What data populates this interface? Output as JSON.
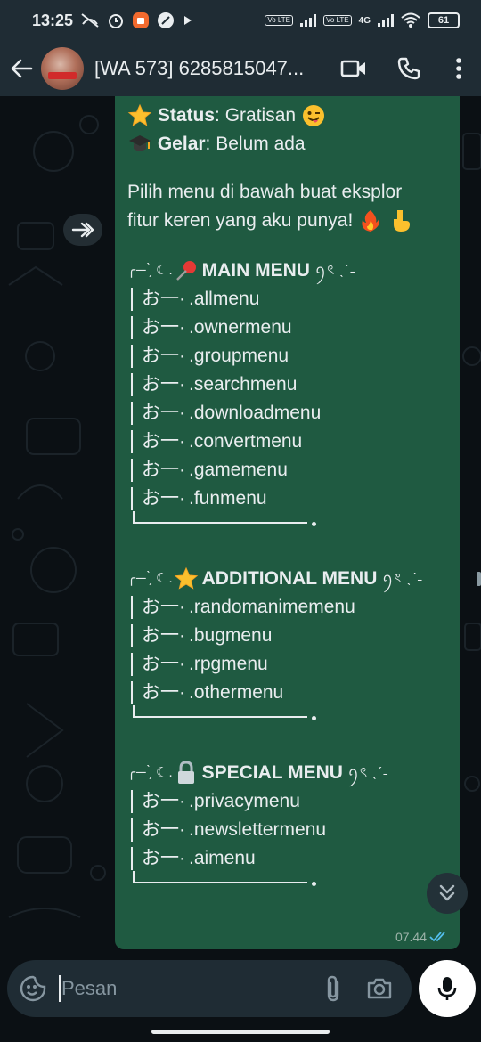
{
  "status_bar": {
    "time": "13:25",
    "net_tag_1": "Vo LTE",
    "net_tag_2": "Vo LTE",
    "net_type": "4G",
    "battery": "61"
  },
  "header": {
    "title": "[WA 573] 6285815047...",
    "back_icon": "arrow-left-icon",
    "video_icon": "video-camera-icon",
    "call_icon": "phone-icon",
    "menu_icon": "more-vertical-icon"
  },
  "message": {
    "status_label": "Status",
    "status_value": ": Gratisan",
    "gelar_label": "Gelar",
    "gelar_value": ": Belum ada",
    "intro_1": "Pilih menu di bawah buat eksplor",
    "intro_2": "fitur keren yang aku punya!",
    "item_prefix": "お一·",
    "deco_left": "╭─ ̗̀ ☾.",
    "deco_right": "ꪆৎ ˎˊ˗",
    "main_menu": {
      "title": "MAIN MENU",
      "items": [
        ".allmenu",
        ".ownermenu",
        ".groupmenu",
        ".searchmenu",
        ".downloadmenu",
        ".convertmenu",
        ".gamemenu",
        ".funmenu"
      ]
    },
    "additional_menu": {
      "title": "ADDITIONAL MENU",
      "items": [
        ".randomanimemenu",
        ".bugmenu",
        ".rpgmenu",
        ".othermenu"
      ]
    },
    "special_menu": {
      "title": "SPECIAL MENU",
      "items": [
        ".privacymenu",
        ".newslettermenu",
        ".aimenu"
      ]
    },
    "time": "07.44"
  },
  "composer": {
    "placeholder": "Pesan",
    "emoji_icon": "sticker-icon",
    "attach_icon": "paperclip-icon",
    "camera_icon": "camera-icon",
    "mic_icon": "microphone-icon"
  },
  "colors": {
    "bubble": "#1f5a41",
    "header": "#1f2c34",
    "background": "#0b1014",
    "read_ticks": "#53bdeb"
  }
}
